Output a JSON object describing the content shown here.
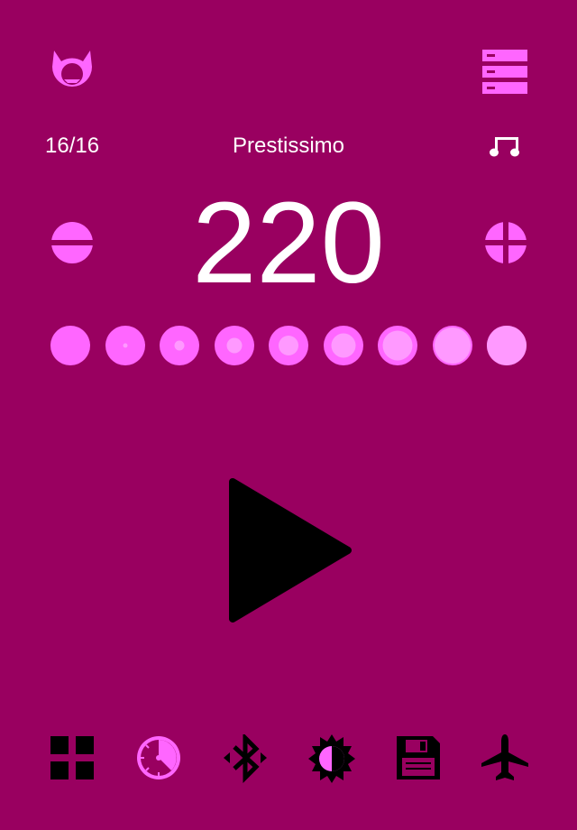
{
  "colors": {
    "background": "#990060",
    "accent": "#ff66ff",
    "accent_light": "#ff99ff",
    "text": "#ffffff",
    "dark": "#000000"
  },
  "header": {
    "logo_icon": "devil-logo-icon",
    "menu_icon": "server-list-icon"
  },
  "info": {
    "beat_count": "16/16",
    "tempo_name": "Prestissimo",
    "note_icon": "music-note-icon"
  },
  "tempo": {
    "bpm": "220",
    "decrease_icon": "minus-circle-icon",
    "increase_icon": "plus-circle-icon"
  },
  "beat_dots": [
    {
      "level": 0.0
    },
    {
      "level": 0.12
    },
    {
      "level": 0.25
    },
    {
      "level": 0.38
    },
    {
      "level": 0.5
    },
    {
      "level": 0.62
    },
    {
      "level": 0.75
    },
    {
      "level": 0.9
    },
    {
      "level": 1.0
    }
  ],
  "play_icon": "play-icon",
  "toolbar": [
    {
      "icon": "grid-icon"
    },
    {
      "icon": "timer-icon"
    },
    {
      "icon": "bluetooth-icon"
    },
    {
      "icon": "brightness-icon"
    },
    {
      "icon": "save-icon"
    },
    {
      "icon": "airplane-icon"
    }
  ]
}
